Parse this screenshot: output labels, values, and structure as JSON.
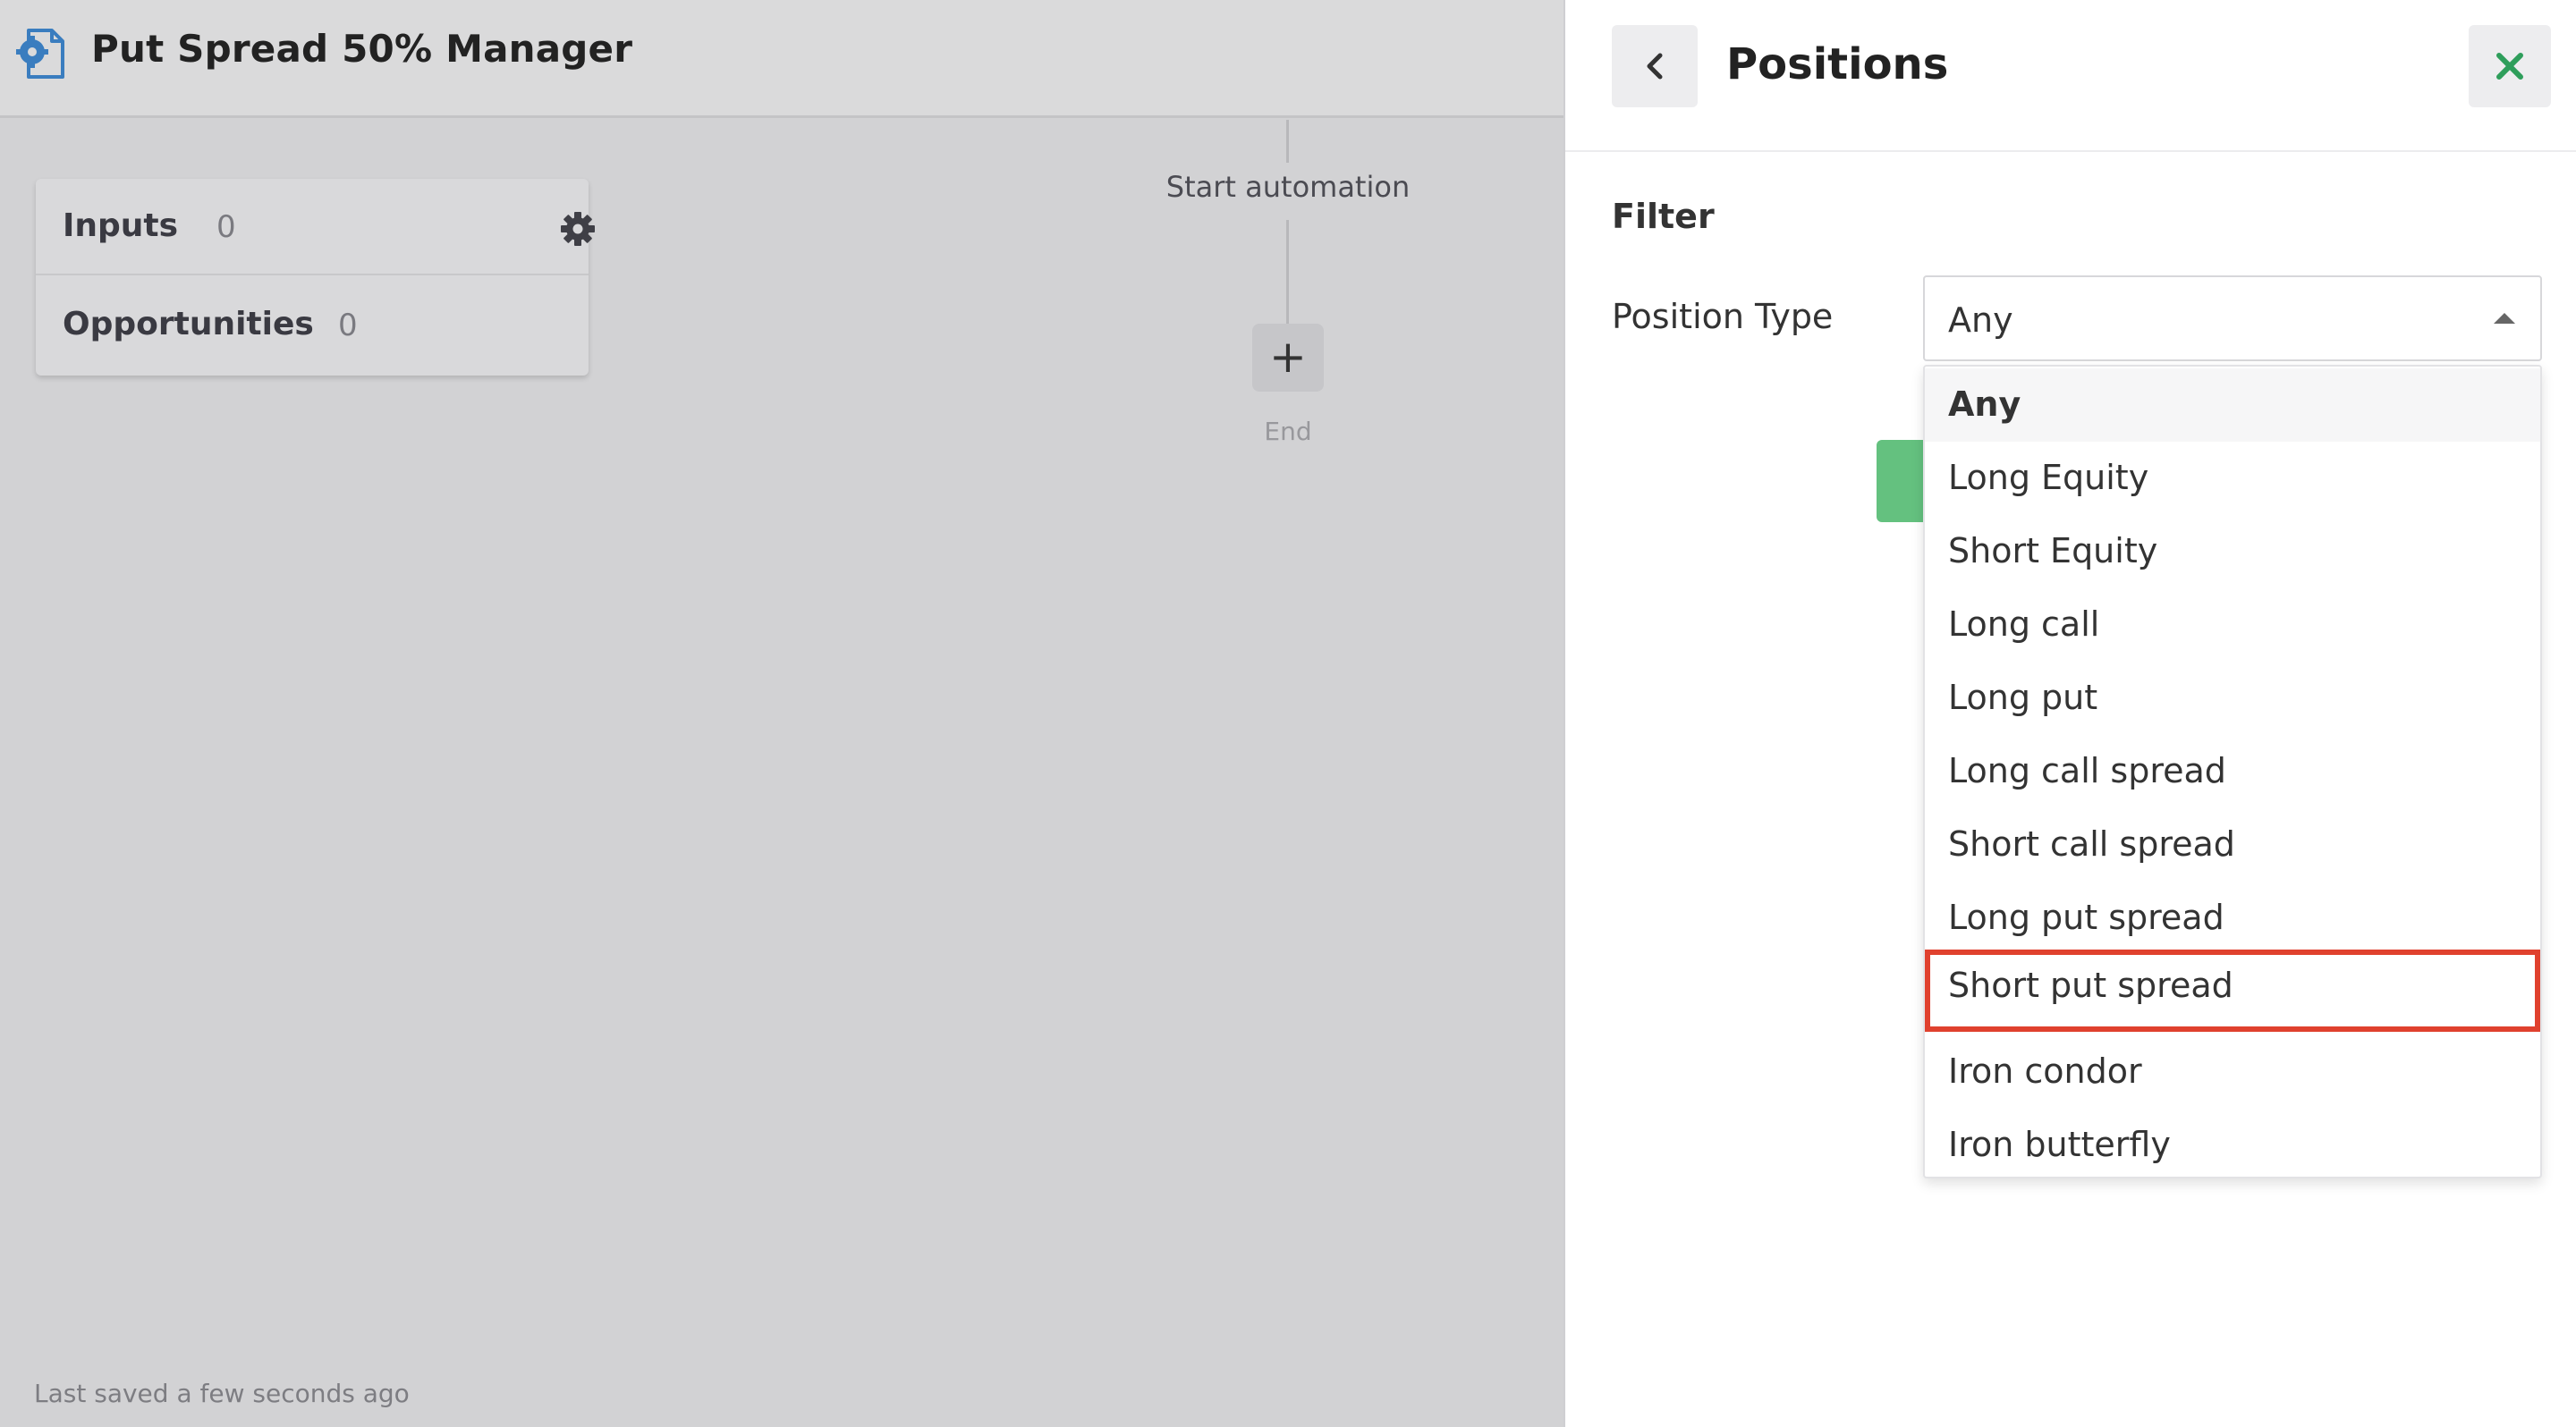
{
  "app": {
    "title": "Put Spread 50% Manager",
    "icon": "automation-doc-gear-icon"
  },
  "inputs_card": {
    "inputs_label": "Inputs",
    "inputs_count": "0",
    "opportunities_label": "Opportunities",
    "opportunities_count": "0",
    "settings_icon": "gear-icon"
  },
  "flow": {
    "start_label": "Start automation",
    "add_symbol": "+",
    "end_label": "End"
  },
  "status": {
    "saved_text": "Last saved a few seconds ago"
  },
  "panel": {
    "title": "Positions",
    "back_icon": "chevron-left-icon",
    "close_icon": "close-icon",
    "filter_heading": "Filter",
    "position_type_label": "Position Type",
    "selected_value": "Any",
    "options": [
      "Any",
      "Long Equity",
      "Short Equity",
      "Long call",
      "Long put",
      "Long call spread",
      "Short call spread",
      "Long put spread",
      "Short put spread",
      "Iron condor",
      "Iron butterfly"
    ],
    "highlighted_option": "Short put spread"
  },
  "colors": {
    "close_accent": "#2e9e5b",
    "app_icon": "#3a7dbf",
    "highlight_border": "#e0412e",
    "green_button": "#64c17f"
  }
}
